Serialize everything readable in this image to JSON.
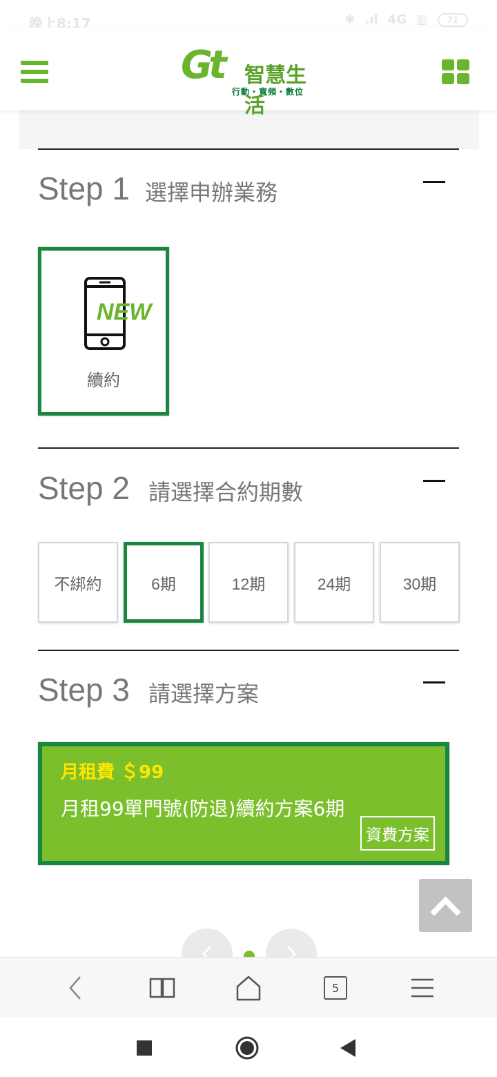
{
  "status_bar": {
    "time": "晚上8:17",
    "network": "4G",
    "battery": "71"
  },
  "header": {
    "logo_mark": "Gt",
    "logo_name": "智慧生活",
    "logo_tagline": "行動・寬頻・數位"
  },
  "steps": [
    {
      "title": "Step 1",
      "subtitle": "選擇申辦業務"
    },
    {
      "title": "Step 2",
      "subtitle": "請選擇合約期數"
    },
    {
      "title": "Step 3",
      "subtitle": "請選擇方案"
    }
  ],
  "service": {
    "badge": "NEW",
    "label": "續約"
  },
  "periods": [
    "不綁約",
    "6期",
    "12期",
    "24期",
    "30期"
  ],
  "selected_period": "6期",
  "plan": {
    "fee": "月租費 ＄99",
    "name": "月租99單門號(防退)續約方案6期",
    "link_label": "資費方案"
  },
  "browser": {
    "tab_count": "5"
  },
  "colors": {
    "brand_green": "#6ab52d",
    "dark_green": "#1a8540",
    "plan_green": "#7bbf2c",
    "fee_yellow": "#ffe600"
  }
}
